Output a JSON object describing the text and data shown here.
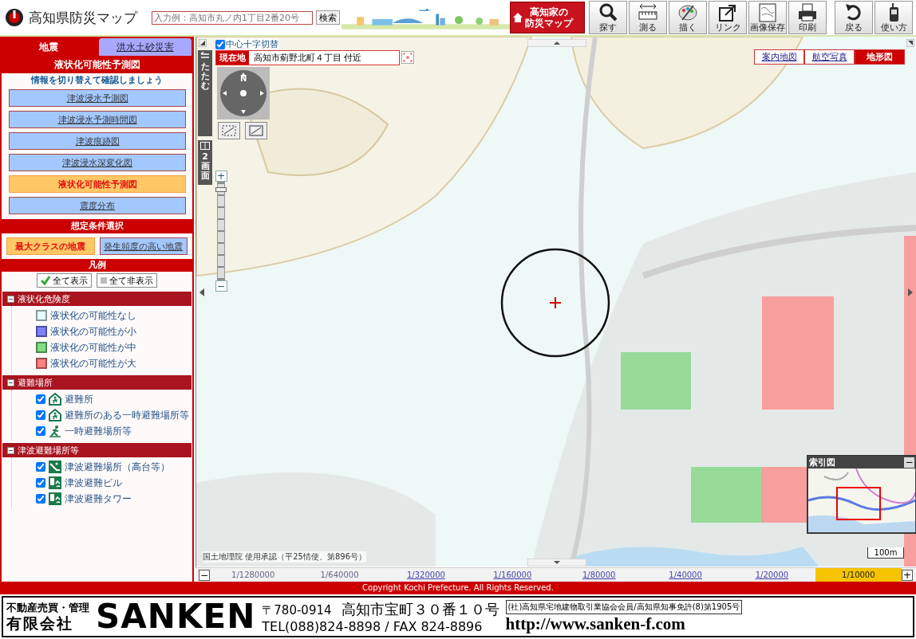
{
  "header": {
    "title": "高知県防災マップ",
    "search": {
      "placeholder": "入力例：高知市丸ノ内1丁目2番20号"
    },
    "search_button": "検索",
    "home_button": [
      "高知家の",
      "防災マップ"
    ],
    "tools": [
      {
        "kind": "search",
        "label": "探す"
      },
      {
        "kind": "measure",
        "label": "測る"
      },
      {
        "kind": "draw",
        "label": "描く"
      },
      {
        "kind": "link",
        "label": "リンク"
      },
      {
        "kind": "save",
        "label": "画像保存"
      },
      {
        "kind": "print",
        "label": "印刷"
      },
      {
        "kind": "back",
        "label": "戻る"
      },
      {
        "kind": "help",
        "label": "使い方"
      }
    ]
  },
  "sidebar": {
    "tabs": [
      {
        "label": "地震",
        "selected": true
      },
      {
        "label": "洪水土砂災害",
        "selected": false
      }
    ],
    "panel_title": "液状化可能性予測図",
    "hint": "情報を切り替えて確認しましょう",
    "maps": [
      {
        "label": "津波浸水予測図",
        "selected": false
      },
      {
        "label": "津波浸水予測時間図",
        "selected": false
      },
      {
        "label": "津波痕跡図",
        "selected": false
      },
      {
        "label": "津波浸水深変化図",
        "selected": false
      },
      {
        "label": "液状化可能性予測図",
        "selected": true
      },
      {
        "label": "震度分布",
        "selected": false
      }
    ],
    "conditions_title": "想定条件選択",
    "conditions": [
      {
        "label": "最大クラスの地震",
        "selected": true
      },
      {
        "label": "発生頻度の高い地震",
        "selected": false
      }
    ],
    "legend": {
      "title": "凡例",
      "show_all": "全て表示",
      "hide_all": "全て非表示",
      "groups": [
        {
          "label": "液状化危険度",
          "expanded": true,
          "items": [
            {
              "kind": "swatch",
              "label": "液状化の可能性なし",
              "color": "#e0ffff"
            },
            {
              "kind": "swatch",
              "label": "液状化の可能性が小",
              "color": "#8080ff"
            },
            {
              "kind": "swatch",
              "label": "液状化の可能性が中",
              "color": "#80e080"
            },
            {
              "kind": "swatch",
              "label": "液状化の可能性が大",
              "color": "#ff8080"
            }
          ]
        },
        {
          "label": "避難場所",
          "expanded": true,
          "items": [
            {
              "kind": "shelter",
              "label": "避難所",
              "checked": true
            },
            {
              "kind": "shelter",
              "label": "避難所のある一時避難場所等",
              "checked": true
            },
            {
              "kind": "runner",
              "label": "一時避難場所等",
              "checked": true
            }
          ]
        },
        {
          "label": "津波避難場所等",
          "expanded": true,
          "items": [
            {
              "kind": "highground",
              "label": "津波避難場所（高台等）",
              "checked": true
            },
            {
              "kind": "building",
              "label": "津波避難ビル",
              "checked": true
            },
            {
              "kind": "building",
              "label": "津波避難タワー",
              "checked": true
            }
          ]
        }
      ]
    }
  },
  "map": {
    "center_cross": {
      "label": "中心十字切替",
      "checked": true
    },
    "location": {
      "label": "現在地",
      "value": "高知市薊野北町４丁目 付近"
    },
    "fold_label": "たたむ",
    "split_label": "2画面",
    "compass_label": "N",
    "zoom": {
      "level": 0.95,
      "in_label": "+",
      "out_label": "−"
    },
    "layer_tabs": [
      {
        "label": "案内地図",
        "selected": false
      },
      {
        "label": "航空写真",
        "selected": false
      },
      {
        "label": "地形図",
        "selected": true
      }
    ],
    "attribution": "国土地理院 使用承認（平25情使、第896号）",
    "index_map": {
      "title": "索引図",
      "minimize_label": "−"
    },
    "scale_label": "100m",
    "scale_out_label": "−",
    "scale_in_label": "+",
    "scales": [
      {
        "label": "1/1280000",
        "selected": false,
        "disabled": true
      },
      {
        "label": "1/640000",
        "selected": false,
        "disabled": true
      },
      {
        "label": "1/320000",
        "selected": false,
        "disabled": false
      },
      {
        "label": "1/160000",
        "selected": false,
        "disabled": false
      },
      {
        "label": "1/80000",
        "selected": false,
        "disabled": false
      },
      {
        "label": "1/40000",
        "selected": false,
        "disabled": false
      },
      {
        "label": "1/20000",
        "selected": false,
        "disabled": false
      },
      {
        "label": "1/10000",
        "selected": true,
        "disabled": false
      }
    ]
  },
  "copyright": "Copyright Kochi Prefecture. All Rights Reserved.",
  "footer": {
    "tagline": "不動産売買・管理",
    "company_type": "有限会社",
    "brand": "SANKEN",
    "postal": "〒780-0914",
    "address": "高知市宝町３０番１０号",
    "phone": "TEL(088)824-8898 / FAX 824-8896",
    "membership": "(社)高知県宅地建物取引業協会会員/高知県知事免許(8)第1905号",
    "url": "http://www.sanken-f.com"
  }
}
